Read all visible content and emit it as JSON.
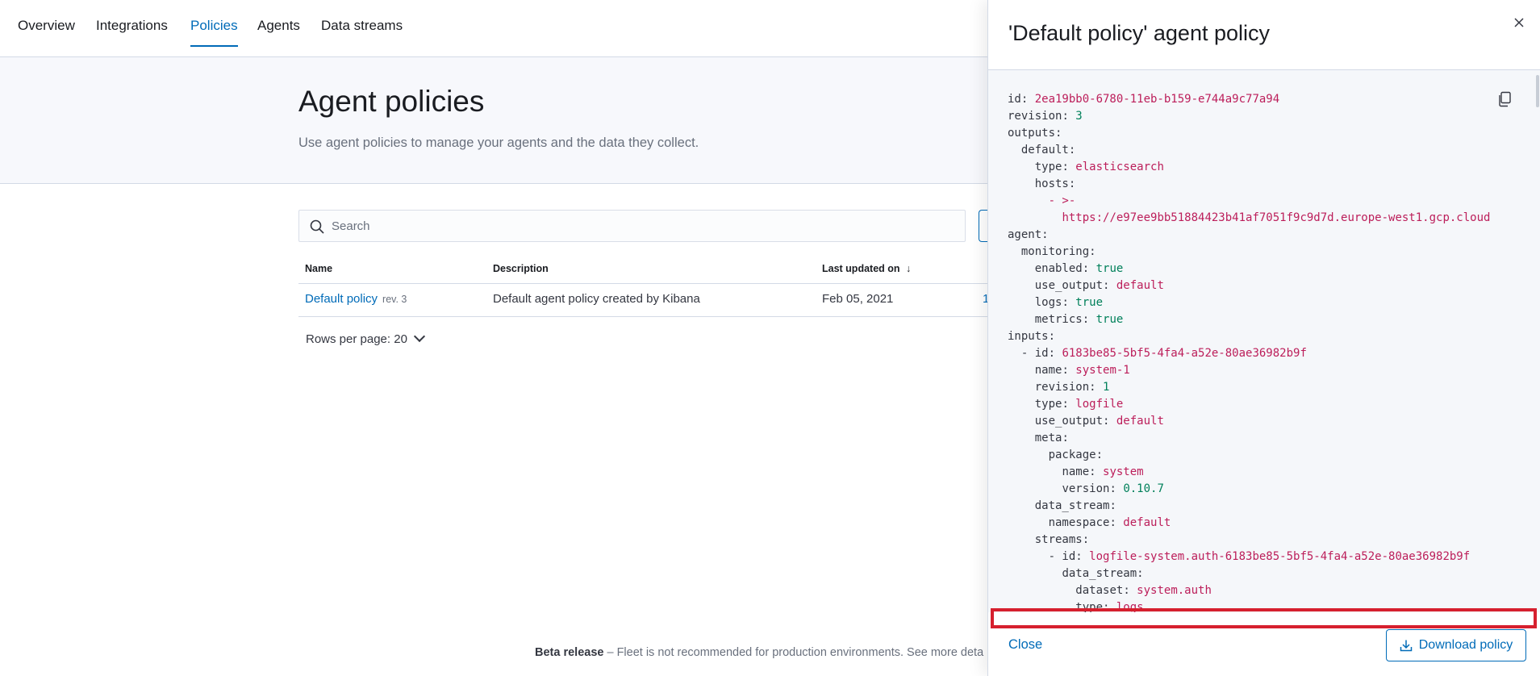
{
  "nav": {
    "tabs": [
      {
        "label": "Overview"
      },
      {
        "label": "Integrations"
      },
      {
        "label": "Policies"
      },
      {
        "label": "Agents"
      },
      {
        "label": "Data streams"
      }
    ],
    "active_tab": "Policies"
  },
  "page": {
    "title": "Agent policies",
    "subtitle": "Use agent policies to manage your agents and the data they collect."
  },
  "search": {
    "placeholder": "Search"
  },
  "table": {
    "columns": [
      "Name",
      "Description",
      "Last updated on"
    ],
    "sort_indicator": "↓",
    "rows": [
      {
        "name": "Default policy",
        "revision": "rev. 3",
        "description": "Default agent policy created by Kibana",
        "updated": "Feb 05, 2021",
        "agents_partial": "1"
      }
    ],
    "rows_per_page": "Rows per page: 20"
  },
  "footer_notice": {
    "bold": "Beta release",
    "text": " – Fleet is not recommended for production environments. See more deta"
  },
  "flyout": {
    "title": "'Default policy' agent policy",
    "close_label": "Close",
    "download_label": "Download policy",
    "yaml": [
      {
        "indent": 0,
        "key": "id",
        "value": "2ea19bb0-6780-11eb-b159-e744a9c77a94",
        "kind": "str"
      },
      {
        "indent": 0,
        "key": "revision",
        "value": "3",
        "kind": "num"
      },
      {
        "indent": 0,
        "key": "outputs",
        "value": "",
        "kind": "none"
      },
      {
        "indent": 1,
        "key": "default",
        "value": "",
        "kind": "none"
      },
      {
        "indent": 2,
        "key": "type",
        "value": "elasticsearch",
        "kind": "str"
      },
      {
        "indent": 2,
        "key": "hosts",
        "value": "",
        "kind": "none"
      },
      {
        "indent": 3,
        "key": "",
        "value": "- >-",
        "kind": "str"
      },
      {
        "indent": 4,
        "key": "",
        "value": "https://e97ee9bb51884423b41af7051f9c9d7d.europe-west1.gcp.cloud",
        "kind": "str"
      },
      {
        "indent": 0,
        "key": "agent",
        "value": "",
        "kind": "none"
      },
      {
        "indent": 1,
        "key": "monitoring",
        "value": "",
        "kind": "none"
      },
      {
        "indent": 2,
        "key": "enabled",
        "value": "true",
        "kind": "num"
      },
      {
        "indent": 2,
        "key": "use_output",
        "value": "default",
        "kind": "str"
      },
      {
        "indent": 2,
        "key": "logs",
        "value": "true",
        "kind": "num"
      },
      {
        "indent": 2,
        "key": "metrics",
        "value": "true",
        "kind": "num"
      },
      {
        "indent": 0,
        "key": "inputs",
        "value": "",
        "kind": "none"
      },
      {
        "indent": 1,
        "key": "- id",
        "value": "6183be85-5bf5-4fa4-a52e-80ae36982b9f",
        "kind": "str"
      },
      {
        "indent": 2,
        "key": "name",
        "value": "system-1",
        "kind": "str"
      },
      {
        "indent": 2,
        "key": "revision",
        "value": "1",
        "kind": "num"
      },
      {
        "indent": 2,
        "key": "type",
        "value": "logfile",
        "kind": "str"
      },
      {
        "indent": 2,
        "key": "use_output",
        "value": "default",
        "kind": "str"
      },
      {
        "indent": 2,
        "key": "meta",
        "value": "",
        "kind": "none"
      },
      {
        "indent": 3,
        "key": "package",
        "value": "",
        "kind": "none"
      },
      {
        "indent": 4,
        "key": "name",
        "value": "system",
        "kind": "str"
      },
      {
        "indent": 4,
        "key": "version",
        "value": "0.10.7",
        "kind": "num"
      },
      {
        "indent": 2,
        "key": "data_stream",
        "value": "",
        "kind": "none"
      },
      {
        "indent": 3,
        "key": "namespace",
        "value": "default",
        "kind": "str"
      },
      {
        "indent": 2,
        "key": "streams",
        "value": "",
        "kind": "none"
      },
      {
        "indent": 3,
        "key": "- id",
        "value": "logfile-system.auth-6183be85-5bf5-4fa4-a52e-80ae36982b9f",
        "kind": "str"
      },
      {
        "indent": 4,
        "key": "data_stream",
        "value": "",
        "kind": "none"
      },
      {
        "indent": 5,
        "key": "dataset",
        "value": "system.auth",
        "kind": "str"
      },
      {
        "indent": 5,
        "key": "type",
        "value": "logs",
        "kind": "str"
      }
    ]
  },
  "colors": {
    "accent": "#006bb8",
    "yaml_string": "#bc1e5a",
    "yaml_number": "#00805a",
    "highlight": "#d6202e"
  }
}
